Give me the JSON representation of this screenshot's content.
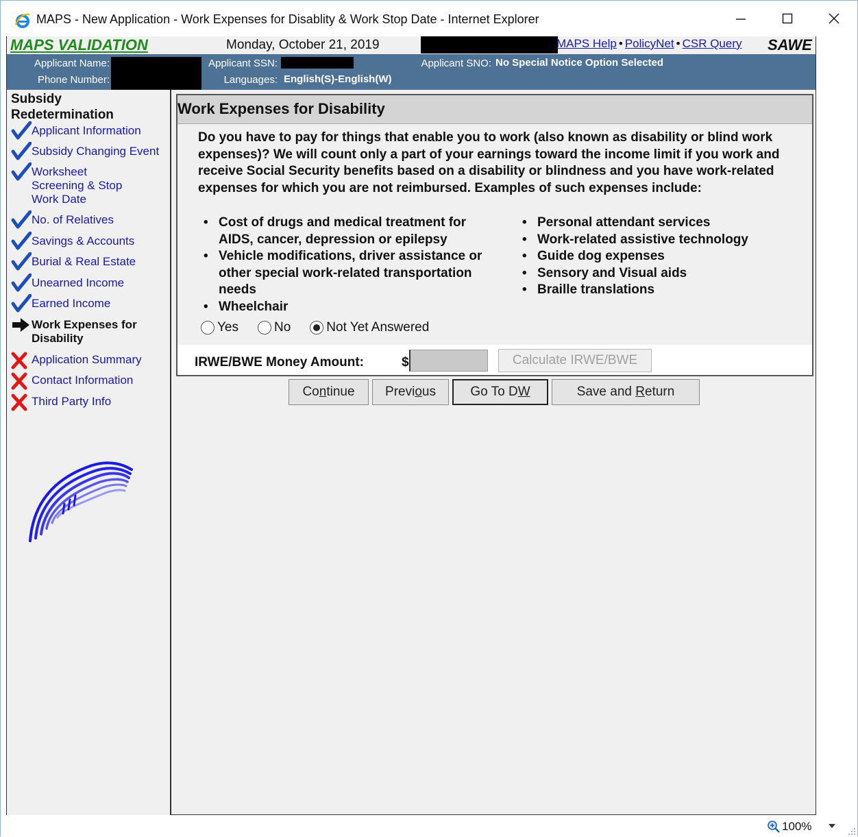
{
  "window": {
    "title": "MAPS - New Application - Work Expenses for Disablity & Work Stop Date - Internet Explorer"
  },
  "header": {
    "app_name": "MAPS VALIDATION",
    "date": "Monday, October 21, 2019",
    "links": [
      "MAPS Help",
      "PolicyNet",
      "CSR Query"
    ],
    "separator": "•",
    "sawe": "SAWE"
  },
  "applicant": {
    "name_label": "Applicant Name:",
    "phone_label": "Phone Number:",
    "ssn_label": "Applicant SSN:",
    "languages_label": "Languages:",
    "languages_value": "English(S)-English(W)",
    "sno_label": "Applicant SNO:",
    "sno_value": "No Special Notice Option Selected"
  },
  "sidebar": {
    "title": "Subsidy Redetermination",
    "items": [
      {
        "label": "Applicant Information",
        "status": "done"
      },
      {
        "label": "Subsidy Changing Event",
        "status": "done"
      },
      {
        "label": "Worksheet Screening  & Stop Work  Date",
        "status": "done"
      },
      {
        "label": "No. of Relatives",
        "status": "done"
      },
      {
        "label": "Savings & Accounts",
        "status": "done"
      },
      {
        "label": "Burial & Real Estate",
        "status": "done"
      },
      {
        "label": "Unearned Income",
        "status": "done"
      },
      {
        "label": "Earned Income",
        "status": "done"
      },
      {
        "label": "Work Expenses for Disability",
        "status": "current"
      },
      {
        "label": "Application Summary",
        "status": "todo"
      },
      {
        "label": "Contact Information",
        "status": "todo"
      },
      {
        "label": "Third Party Info",
        "status": "todo"
      }
    ]
  },
  "main": {
    "section_title": "Work Expenses for Disability",
    "question": "Do you have to pay for things that enable you to work (also known as disability or blind work expenses)? We will count only a part of your earnings toward the income limit if you work and receive Social Security benefits based on a disability or blindness and you have work-related expenses for which you are not reimbursed. Examples of such expenses include:",
    "bullets_left": [
      "Cost of drugs and medical treatment for AIDS, cancer, depression or epilepsy",
      "Vehicle modifications, driver assistance or other special work-related transportation needs",
      "Wheelchair"
    ],
    "bullets_right": [
      "Personal attendant services",
      "Work-related assistive technology",
      "Guide dog expenses",
      "Sensory and Visual aids",
      "Braille translations"
    ],
    "radio_options": [
      {
        "label": "Yes",
        "selected": false
      },
      {
        "label": "No",
        "selected": false
      },
      {
        "label": "Not Yet Answered",
        "selected": true
      }
    ],
    "money_label": "IRWE/BWE Money Amount:",
    "currency": "$",
    "money_value": "",
    "calculate_label": "Calculate IRWE/BWE"
  },
  "buttons": {
    "continue": {
      "pre": "Co",
      "key": "n",
      "post": "tinue"
    },
    "previous": {
      "pre": "Previ",
      "key": "o",
      "post": "us"
    },
    "gotodw": {
      "pre": "Go To D",
      "key": "W",
      "post": ""
    },
    "save": {
      "pre": "Save and ",
      "key": "R",
      "post": "eturn"
    }
  },
  "status": {
    "zoom": "100%"
  },
  "colors": {
    "app_green": "#1f8b1f",
    "link_blue": "#1a1aa6",
    "info_bar": "#4e7295",
    "check_blue": "#1e4fb8",
    "x_red": "#e01818"
  }
}
